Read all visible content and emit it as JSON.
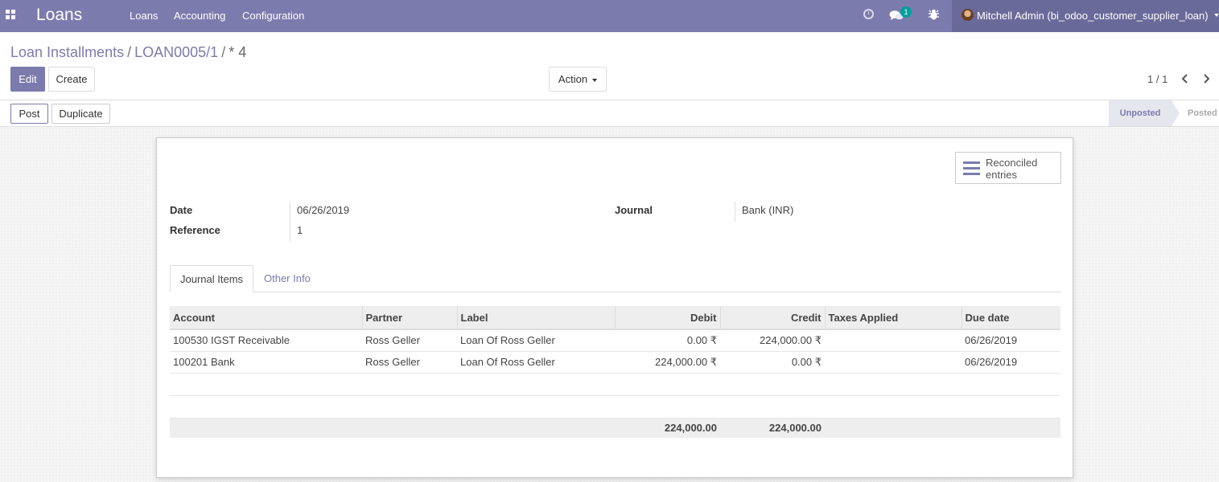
{
  "navbar": {
    "brand": "Loans",
    "menu": [
      "Loans",
      "Accounting",
      "Configuration"
    ],
    "chat_badge": "1",
    "user": "Mitchell Admin (bi_odoo_customer_supplier_loan)"
  },
  "breadcrumb": {
    "root": "Loan Installments",
    "record": "LOAN0005/1",
    "current": "* 4"
  },
  "buttons": {
    "edit": "Edit",
    "create": "Create",
    "action": "Action",
    "post": "Post",
    "duplicate": "Duplicate"
  },
  "pager": "1 / 1",
  "statusbar": {
    "unposted": "Unposted",
    "posted": "Posted"
  },
  "smart_button": {
    "label": "Reconciled entries"
  },
  "fields": {
    "date_label": "Date",
    "date_value": "06/26/2019",
    "reference_label": "Reference",
    "reference_value": "1",
    "journal_label": "Journal",
    "journal_value": "Bank (INR)"
  },
  "tabs": [
    "Journal Items",
    "Other Info"
  ],
  "table": {
    "columns": [
      "Account",
      "Partner",
      "Label",
      "Debit",
      "Credit",
      "Taxes Applied",
      "Due date"
    ],
    "rows": [
      [
        "100530 IGST Receivable",
        "Ross Geller",
        "Loan Of Ross Geller",
        "0.00 ₹",
        "224,000.00 ₹",
        "",
        "06/26/2019"
      ],
      [
        "100201 Bank",
        "Ross Geller",
        "Loan Of Ross Geller",
        "224,000.00 ₹",
        "0.00 ₹",
        "",
        "06/26/2019"
      ]
    ],
    "totals": {
      "debit": "224,000.00",
      "credit": "224,000.00"
    }
  },
  "colors": {
    "brand": "#7c7bad",
    "user_box": "#6a6a9a",
    "badge": "#00a09d"
  }
}
